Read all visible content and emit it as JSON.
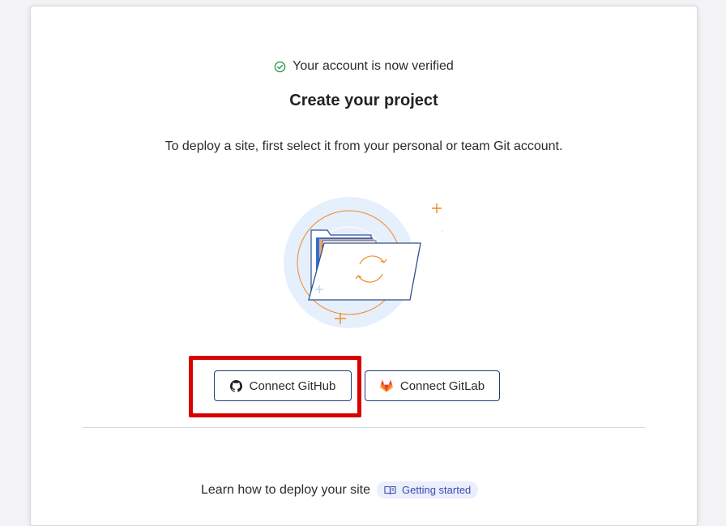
{
  "header": {
    "verified_text": "Your account is now verified",
    "title": "Create your project",
    "subtitle": "To deploy a site, first select it from your personal or team Git account."
  },
  "buttons": {
    "github_label": "Connect GitHub",
    "gitlab_label": "Connect GitLab",
    "github_icon": "github-icon",
    "gitlab_icon": "gitlab-icon"
  },
  "footer": {
    "learn_text": "Learn how to deploy your site",
    "getting_started_label": "Getting started",
    "getting_started_icon": "book-icon"
  },
  "colors": {
    "accent_border": "#1f3f7a",
    "highlight": "#d90000",
    "success": "#2e9a4e",
    "pill_bg": "#ebeefc",
    "pill_text": "#3d4ab0",
    "illustration_orange": "#f08a24",
    "illustration_blue": "#2f6fd6"
  }
}
